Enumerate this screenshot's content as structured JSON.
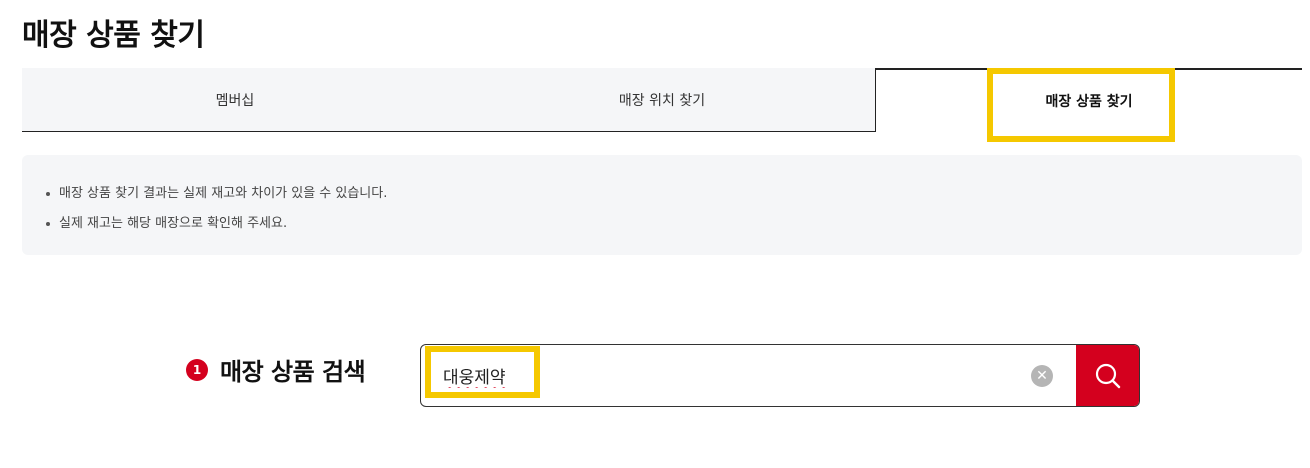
{
  "page": {
    "title": "매장 상품 찾기"
  },
  "tabs": [
    {
      "label": "멤버십"
    },
    {
      "label": "매장 위치 찾기"
    },
    {
      "label": "매장 상품 찾기",
      "active": true
    }
  ],
  "notice": {
    "items": [
      "매장 상품 찾기 결과는 실제 재고와 차이가 있을 수 있습니다.",
      "실제 재고는 해당 매장으로 확인해 주세요."
    ]
  },
  "search": {
    "step": "1",
    "label": "매장 상품 검색",
    "value": "대웅제약",
    "clear_icon": "clear-icon",
    "search_icon": "search-icon"
  },
  "colors": {
    "accent": "#d4001e",
    "highlight": "#f5c800",
    "panel_bg": "#f5f6f8"
  }
}
